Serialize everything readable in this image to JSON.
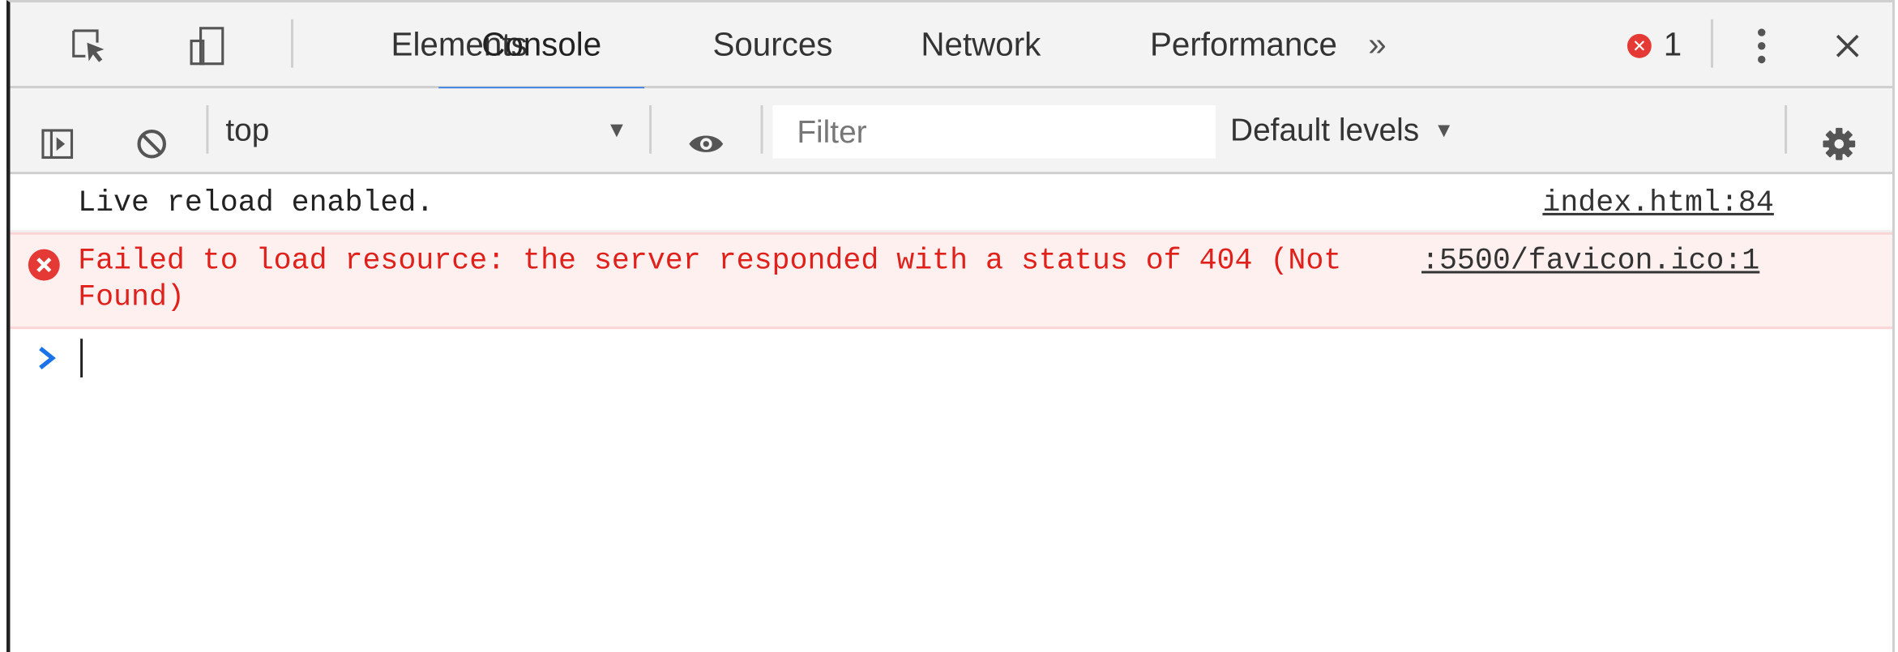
{
  "tabs": [
    {
      "label": "Elements",
      "active": false
    },
    {
      "label": "Console",
      "active": true
    },
    {
      "label": "Sources",
      "active": false
    },
    {
      "label": "Network",
      "active": false
    },
    {
      "label": "Performance",
      "active": false
    }
  ],
  "more_tabs_label": "»",
  "error_count": "1",
  "toolbar": {
    "context_label": "top",
    "filter_placeholder": "Filter",
    "levels_label": "Default levels"
  },
  "messages": [
    {
      "level": "info",
      "text": "Live reload enabled.",
      "source": "index.html:84"
    },
    {
      "level": "error",
      "text": "Failed to load resource: the server responded with a status of 404 (Not Found)",
      "source": ":5500/favicon.ico:1"
    }
  ],
  "icons": {
    "inspect": "inspect-element-icon",
    "device": "device-toolbar-icon",
    "sidebar": "show-sidebar-icon",
    "clear": "clear-console-icon",
    "eye": "live-expression-icon",
    "gear": "gear-icon",
    "menu": "kebab-menu-icon",
    "close": "close-icon"
  },
  "colors": {
    "accent": "#1a73e8",
    "error_text": "#e0201a",
    "error_bg": "#fff0f0",
    "error_badge": "#e53935",
    "prompt": "#1a73e8"
  }
}
